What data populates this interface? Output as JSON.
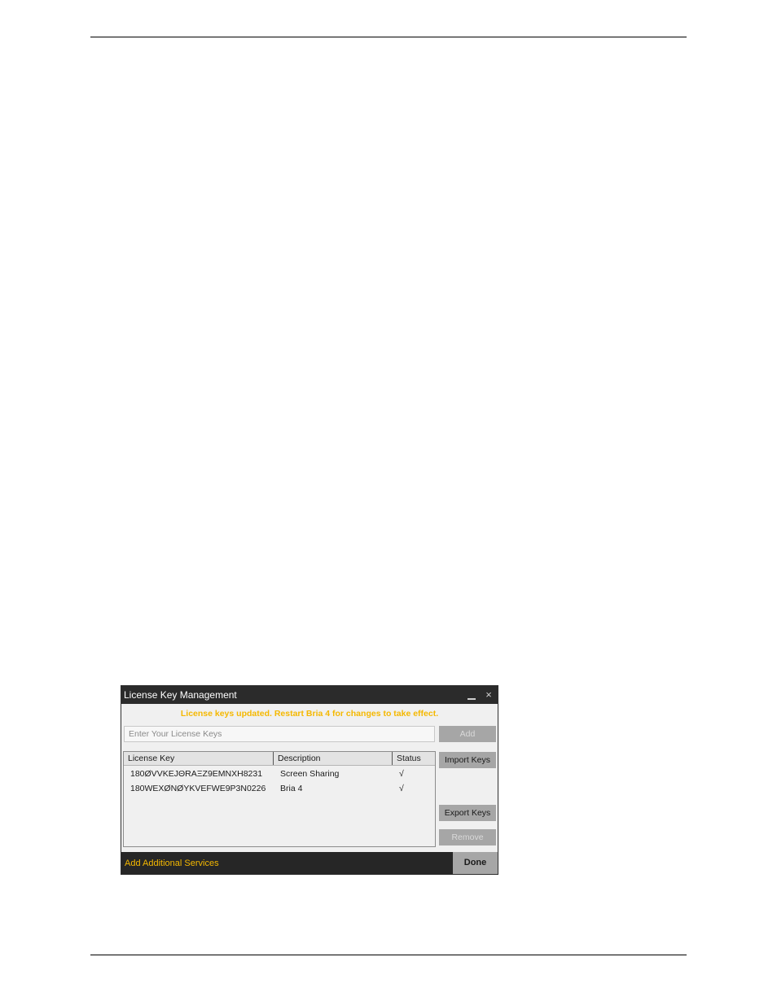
{
  "dialog": {
    "title": "License Key Management",
    "window_controls": {
      "minimize": "minimize-icon",
      "close": "×"
    },
    "status_message": "License keys updated. Restart Bria 4 for changes to take effect.",
    "input": {
      "placeholder": "Enter Your License Keys",
      "value": ""
    },
    "buttons": {
      "add": "Add",
      "import": "Import Keys",
      "export": "Export Keys",
      "remove": "Remove",
      "done": "Done"
    },
    "table": {
      "columns": [
        "License Key",
        "Description",
        "Status"
      ],
      "rows": [
        {
          "key": "180ØVVKEJΘRAΞZ9EMNXH8231",
          "description": "Screen Sharing",
          "status": "√"
        },
        {
          "key": "180WEXØNØYKVEFWE9P3N0226",
          "description": "Bria 4",
          "status": "√"
        }
      ]
    },
    "footer_link": "Add Additional Services"
  },
  "colors": {
    "accent": "#f5b800",
    "titlebar": "#2b2b2b",
    "footer": "#262626",
    "button": "#a6a6a6",
    "dialog_bg": "#f0f0f0"
  }
}
